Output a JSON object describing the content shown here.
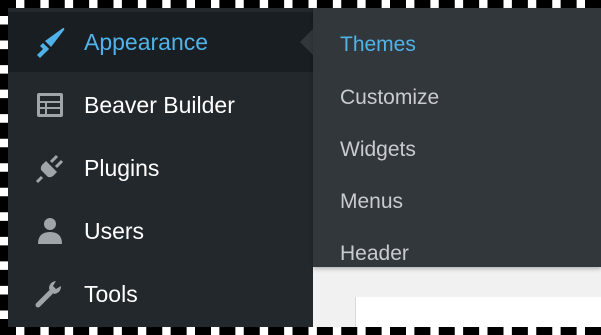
{
  "sidebar": {
    "items": [
      {
        "label": "Appearance",
        "icon": "paintbrush-icon",
        "active": true
      },
      {
        "label": "Beaver Builder",
        "icon": "grid-layout-icon",
        "active": false
      },
      {
        "label": "Plugins",
        "icon": "plug-icon",
        "active": false
      },
      {
        "label": "Users",
        "icon": "user-icon",
        "active": false
      },
      {
        "label": "Tools",
        "icon": "wrench-icon",
        "active": false
      }
    ]
  },
  "submenu": {
    "items": [
      {
        "label": "Themes",
        "active": true
      },
      {
        "label": "Customize",
        "active": false
      },
      {
        "label": "Widgets",
        "active": false
      },
      {
        "label": "Menus",
        "active": false
      },
      {
        "label": "Header",
        "active": false
      }
    ]
  },
  "colors": {
    "sidebar_bg": "#23282d",
    "sidebar_active_bg": "#191e23",
    "submenu_bg": "#32373c",
    "accent": "#4fb3e9",
    "submenu_text": "#c8cbcf",
    "icon_gray": "#a0a5aa"
  }
}
